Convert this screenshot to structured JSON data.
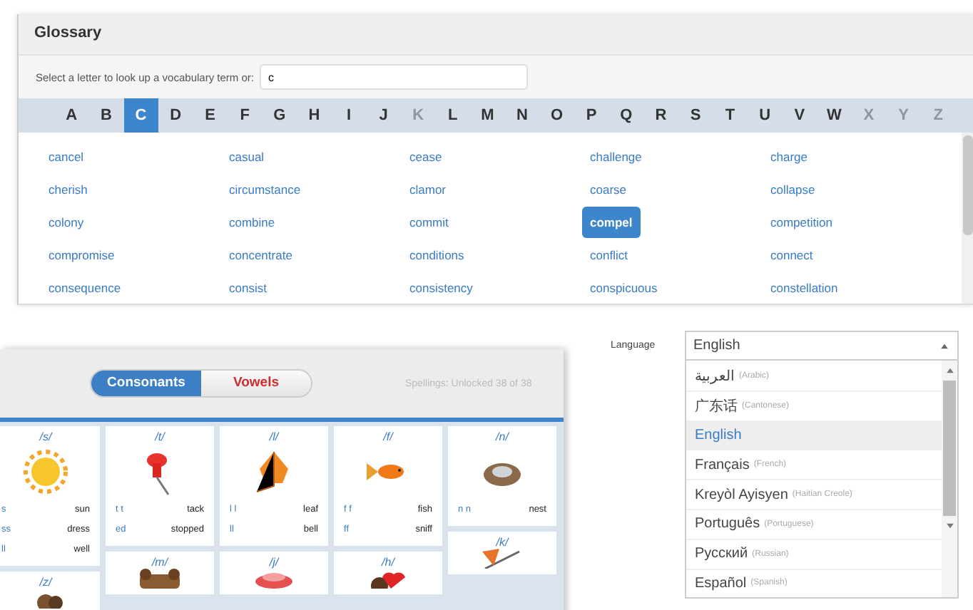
{
  "glossary": {
    "title": "Glossary",
    "search": {
      "label": "Select a letter to look up a vocabulary term or:",
      "value": "c"
    },
    "letters": [
      {
        "label": "A",
        "selected": false,
        "disabled": false
      },
      {
        "label": "B",
        "selected": false,
        "disabled": false
      },
      {
        "label": "C",
        "selected": true,
        "disabled": false
      },
      {
        "label": "D",
        "selected": false,
        "disabled": false
      },
      {
        "label": "E",
        "selected": false,
        "disabled": false
      },
      {
        "label": "F",
        "selected": false,
        "disabled": false
      },
      {
        "label": "G",
        "selected": false,
        "disabled": false
      },
      {
        "label": "H",
        "selected": false,
        "disabled": false
      },
      {
        "label": "I",
        "selected": false,
        "disabled": false
      },
      {
        "label": "J",
        "selected": false,
        "disabled": false
      },
      {
        "label": "K",
        "selected": false,
        "disabled": true
      },
      {
        "label": "L",
        "selected": false,
        "disabled": false
      },
      {
        "label": "M",
        "selected": false,
        "disabled": false
      },
      {
        "label": "N",
        "selected": false,
        "disabled": false
      },
      {
        "label": "O",
        "selected": false,
        "disabled": false
      },
      {
        "label": "P",
        "selected": false,
        "disabled": false
      },
      {
        "label": "Q",
        "selected": false,
        "disabled": false
      },
      {
        "label": "R",
        "selected": false,
        "disabled": false
      },
      {
        "label": "S",
        "selected": false,
        "disabled": false
      },
      {
        "label": "T",
        "selected": false,
        "disabled": false
      },
      {
        "label": "U",
        "selected": false,
        "disabled": false
      },
      {
        "label": "V",
        "selected": false,
        "disabled": false
      },
      {
        "label": "W",
        "selected": false,
        "disabled": false
      },
      {
        "label": "X",
        "selected": false,
        "disabled": true
      },
      {
        "label": "Y",
        "selected": false,
        "disabled": true
      },
      {
        "label": "Z",
        "selected": false,
        "disabled": true
      }
    ],
    "terms": [
      {
        "label": "cancel",
        "selected": false
      },
      {
        "label": "casual",
        "selected": false
      },
      {
        "label": "cease",
        "selected": false
      },
      {
        "label": "challenge",
        "selected": false
      },
      {
        "label": "charge",
        "selected": false
      },
      {
        "label": "cherish",
        "selected": false
      },
      {
        "label": "circumstance",
        "selected": false
      },
      {
        "label": "clamor",
        "selected": false
      },
      {
        "label": "coarse",
        "selected": false
      },
      {
        "label": "collapse",
        "selected": false
      },
      {
        "label": "colony",
        "selected": false
      },
      {
        "label": "combine",
        "selected": false
      },
      {
        "label": "commit",
        "selected": false
      },
      {
        "label": "compel",
        "selected": true
      },
      {
        "label": "competition",
        "selected": false
      },
      {
        "label": "compromise",
        "selected": false
      },
      {
        "label": "concentrate",
        "selected": false
      },
      {
        "label": "conditions",
        "selected": false
      },
      {
        "label": "conflict",
        "selected": false
      },
      {
        "label": "connect",
        "selected": false
      },
      {
        "label": "consequence",
        "selected": false
      },
      {
        "label": "consist",
        "selected": false
      },
      {
        "label": "consistency",
        "selected": false
      },
      {
        "label": "conspicuous",
        "selected": false
      },
      {
        "label": "constellation",
        "selected": false
      }
    ]
  },
  "phonics": {
    "tabs": [
      {
        "label": "Consonants",
        "selected": true
      },
      {
        "label": "Vowels",
        "selected": false
      }
    ],
    "progress": "Spellings: Unlocked 38 of 38",
    "columns": [
      {
        "cards": [
          {
            "sound": "/s/",
            "words": [
              {
                "spelling": "s",
                "example": "sun"
              },
              {
                "spelling": "ss",
                "example": "dress"
              },
              {
                "spelling": "ll",
                "example": "well"
              }
            ]
          },
          {
            "sound": "/z/"
          }
        ]
      },
      {
        "cards": [
          {
            "sound": "/t/",
            "words": [
              {
                "spelling": "t t",
                "example": "tack"
              },
              {
                "spelling": "ed",
                "example": "stopped"
              }
            ]
          },
          {
            "sound": "/m/"
          }
        ]
      },
      {
        "cards": [
          {
            "sound": "/l/",
            "words": [
              {
                "spelling": "l l",
                "example": "leaf"
              },
              {
                "spelling": "ll",
                "example": "bell"
              }
            ]
          },
          {
            "sound": "/j/"
          }
        ]
      },
      {
        "cards": [
          {
            "sound": "/f/",
            "words": [
              {
                "spelling": "f f",
                "example": "fish"
              },
              {
                "spelling": "ff",
                "example": "sniff"
              }
            ]
          },
          {
            "sound": "/h/"
          }
        ]
      },
      {
        "cards": [
          {
            "sound": "/n/",
            "words": [
              {
                "spelling": "n n",
                "example": "nest"
              }
            ]
          },
          {
            "sound": "/k/"
          }
        ]
      }
    ]
  },
  "language": {
    "label": "Language",
    "value": "English",
    "options": [
      {
        "name": "العربية",
        "english": "(Arabic)",
        "selected": false
      },
      {
        "name": "广东话",
        "english": "(Cantonese)",
        "selected": false
      },
      {
        "name": "English",
        "selected": true
      },
      {
        "name": "Français",
        "english": "(French)",
        "selected": false
      },
      {
        "name": "Kreyòl Ayisyen",
        "english": "(Haitian Creole)",
        "selected": false
      },
      {
        "name": "Português",
        "english": "(Portuguese)",
        "selected": false
      },
      {
        "name": "Русский",
        "english": "(Russian)",
        "selected": false
      },
      {
        "name": "Español",
        "english": "(Spanish)",
        "selected": false
      }
    ]
  }
}
